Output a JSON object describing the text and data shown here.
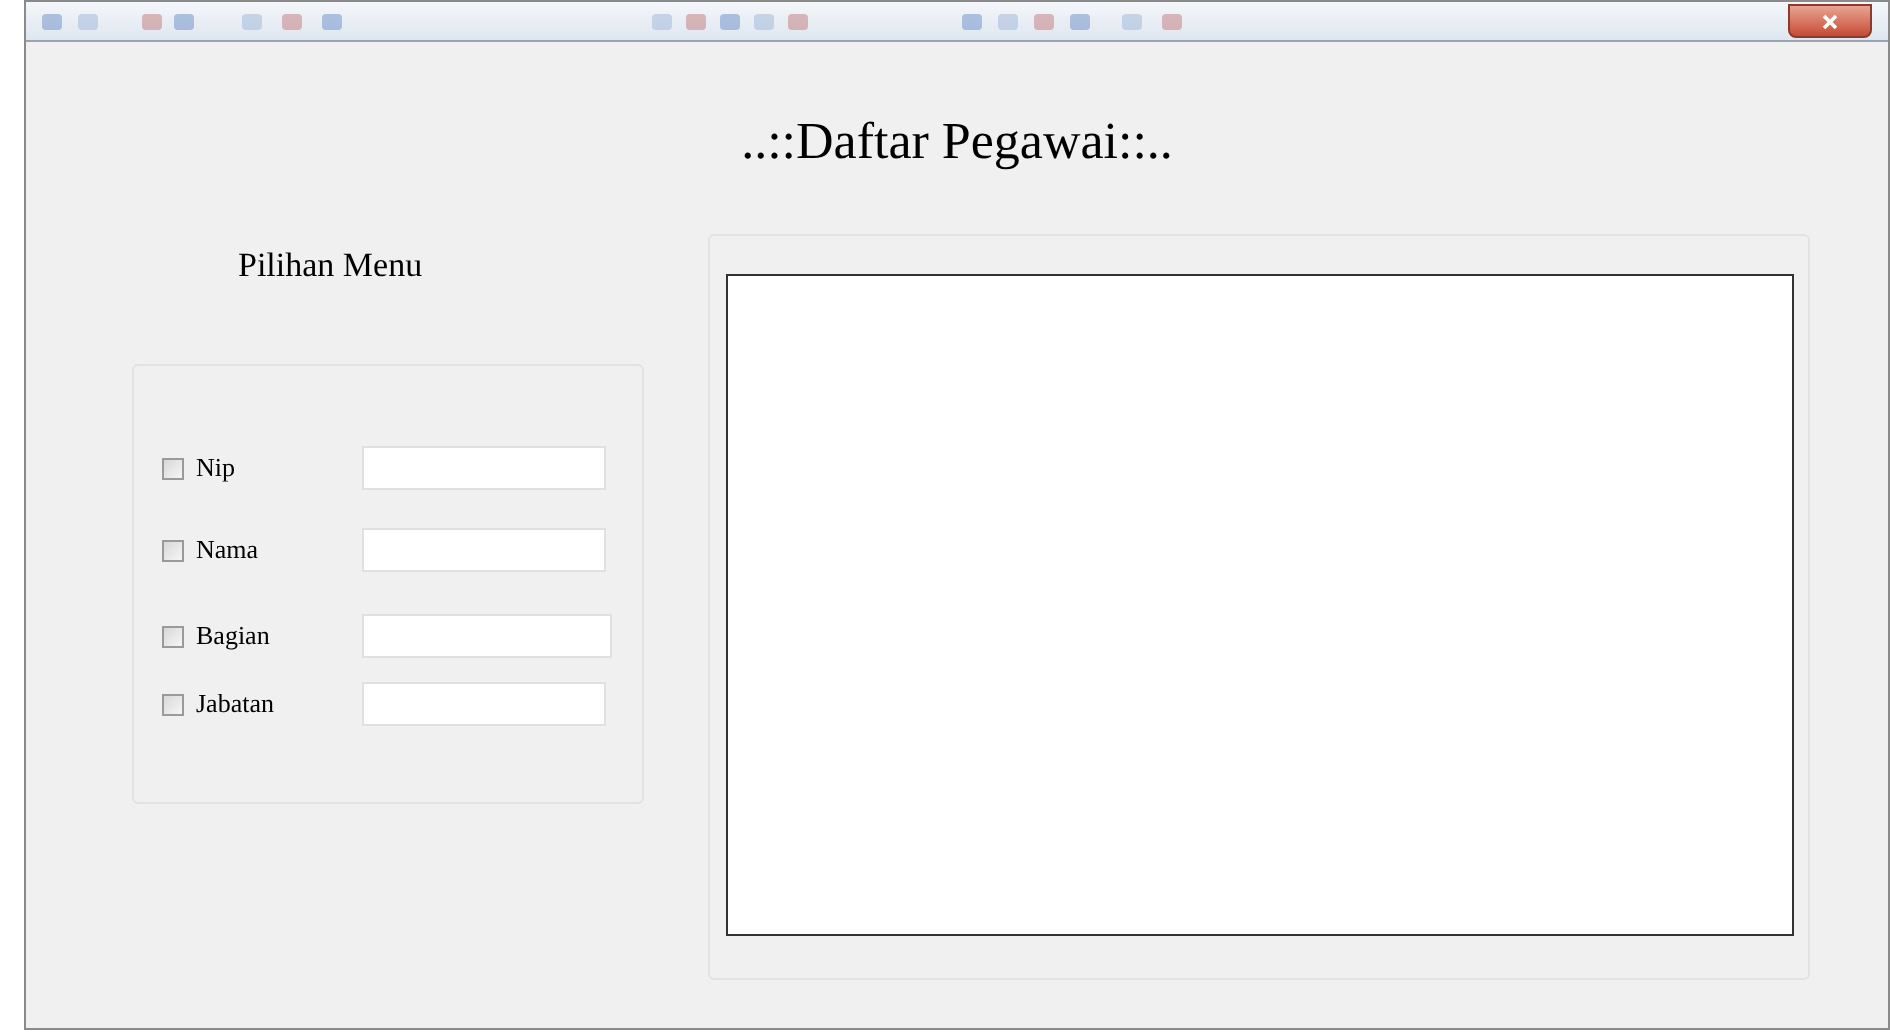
{
  "window": {
    "title": "..::Daftar Pegawai::.."
  },
  "menu": {
    "heading": "Pilihan Menu",
    "options": [
      {
        "label": "Nip",
        "checked": false
      },
      {
        "label": "Nama",
        "checked": false
      },
      {
        "label": "Bagian",
        "checked": false
      },
      {
        "label": "Jabatan",
        "checked": false
      }
    ]
  }
}
